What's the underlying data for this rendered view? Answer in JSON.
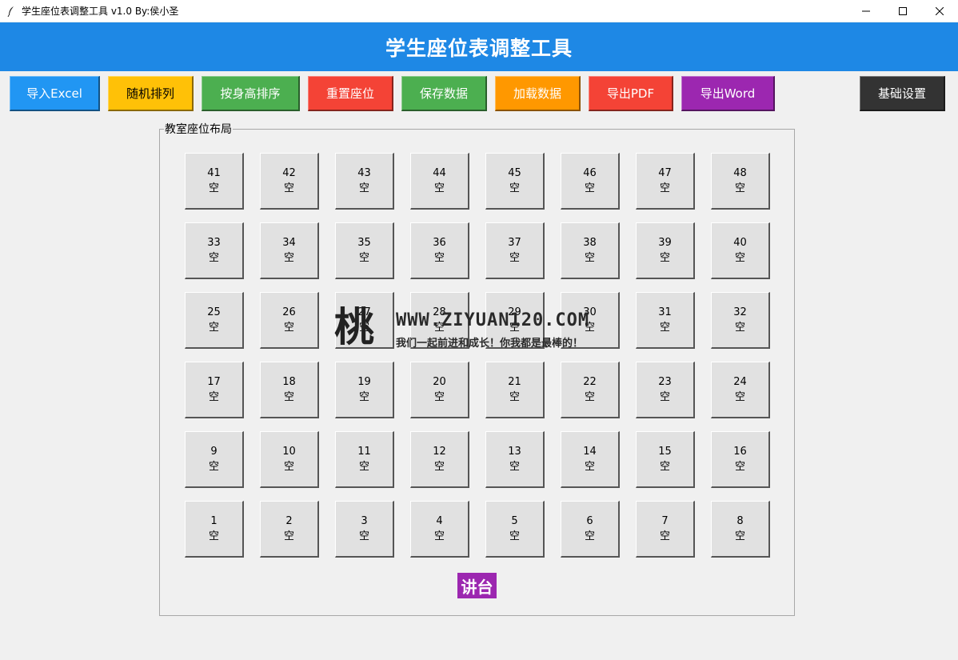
{
  "window": {
    "title": "学生座位表调整工具 v1.0 By:侯小圣"
  },
  "header": {
    "title": "学生座位表调整工具"
  },
  "toolbar": {
    "buttons": [
      {
        "label": "导入Excel",
        "color": "#2196f3"
      },
      {
        "label": "随机排列",
        "color": "#ffc107"
      },
      {
        "label": "按身高排序",
        "color": "#4caf50"
      },
      {
        "label": "重置座位",
        "color": "#f44336"
      },
      {
        "label": "保存数据",
        "color": "#4caf50"
      },
      {
        "label": "加载数据",
        "color": "#ff9800"
      },
      {
        "label": "导出PDF",
        "color": "#f44336"
      },
      {
        "label": "导出Word",
        "color": "#9c27b0"
      },
      {
        "label": "基础设置",
        "color": "#333333"
      }
    ]
  },
  "classroom": {
    "label": "教室座位布局",
    "seats": [
      {
        "number": "41",
        "name": "空"
      },
      {
        "number": "42",
        "name": "空"
      },
      {
        "number": "43",
        "name": "空"
      },
      {
        "number": "44",
        "name": "空"
      },
      {
        "number": "45",
        "name": "空"
      },
      {
        "number": "46",
        "name": "空"
      },
      {
        "number": "47",
        "name": "空"
      },
      {
        "number": "48",
        "name": "空"
      },
      {
        "number": "33",
        "name": "空"
      },
      {
        "number": "34",
        "name": "空"
      },
      {
        "number": "35",
        "name": "空"
      },
      {
        "number": "36",
        "name": "空"
      },
      {
        "number": "37",
        "name": "空"
      },
      {
        "number": "38",
        "name": "空"
      },
      {
        "number": "39",
        "name": "空"
      },
      {
        "number": "40",
        "name": "空"
      },
      {
        "number": "25",
        "name": "空"
      },
      {
        "number": "26",
        "name": "空"
      },
      {
        "number": "27",
        "name": "空"
      },
      {
        "number": "28",
        "name": "空"
      },
      {
        "number": "29",
        "name": "空"
      },
      {
        "number": "30",
        "name": "空"
      },
      {
        "number": "31",
        "name": "空"
      },
      {
        "number": "32",
        "name": "空"
      },
      {
        "number": "17",
        "name": "空"
      },
      {
        "number": "18",
        "name": "空"
      },
      {
        "number": "19",
        "name": "空"
      },
      {
        "number": "20",
        "name": "空"
      },
      {
        "number": "21",
        "name": "空"
      },
      {
        "number": "22",
        "name": "空"
      },
      {
        "number": "23",
        "name": "空"
      },
      {
        "number": "24",
        "name": "空"
      },
      {
        "number": "9",
        "name": "空"
      },
      {
        "number": "10",
        "name": "空"
      },
      {
        "number": "11",
        "name": "空"
      },
      {
        "number": "12",
        "name": "空"
      },
      {
        "number": "13",
        "name": "空"
      },
      {
        "number": "14",
        "name": "空"
      },
      {
        "number": "15",
        "name": "空"
      },
      {
        "number": "16",
        "name": "空"
      },
      {
        "number": "1",
        "name": "空"
      },
      {
        "number": "2",
        "name": "空"
      },
      {
        "number": "3",
        "name": "空"
      },
      {
        "number": "4",
        "name": "空"
      },
      {
        "number": "5",
        "name": "空"
      },
      {
        "number": "6",
        "name": "空"
      },
      {
        "number": "7",
        "name": "空"
      },
      {
        "number": "8",
        "name": "空"
      }
    ],
    "podium": "讲台"
  },
  "watermark": {
    "logo": "桃",
    "url": "WWW.ZIYUAN120.COM",
    "slogan": "我们一起前进和成长！你我都是最棒的！"
  },
  "icons": {
    "app": "feather-icon",
    "minimize": "minimize-icon",
    "maximize": "maximize-icon",
    "close": "close-icon"
  }
}
